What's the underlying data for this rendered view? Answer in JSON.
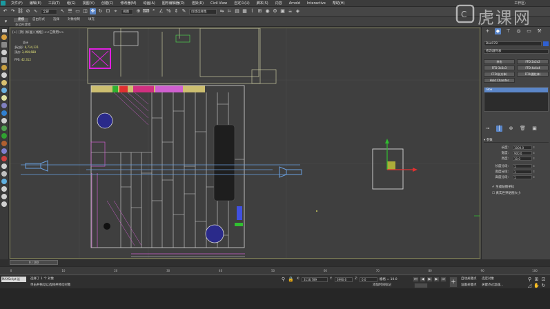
{
  "menubar": {
    "items": [
      "文件(F)",
      "编辑(E)",
      "工具(T)",
      "组(G)",
      "视图(V)",
      "创建(C)",
      "修改器(M)",
      "动画(A)",
      "图形编辑器(D)",
      "渲染(R)",
      "Civil View",
      "自定义(U)",
      "脚本(S)",
      "内容",
      "Arnold",
      "Interactive",
      "帮助(H)"
    ],
    "workspace_label": "工作区:"
  },
  "toolbar": {
    "filter_value": "全部",
    "selection_set_placeholder": "创建选择集"
  },
  "ribbon": {
    "tabs": [
      "建模",
      "自由形式",
      "选择",
      "对象绘制",
      "填充"
    ],
    "active_tab": 0,
    "sub_label": "多边形建模"
  },
  "viewport": {
    "label": "[+] [顶] [标准] [线框] <<已禁用>>",
    "stats_title": "总计",
    "polys_label": "多边形:",
    "polys_value": "6,734,221",
    "verts_label": "顶点:",
    "verts_value": "3,494,688",
    "fps_label": "FPS:",
    "fps_value": "42.312"
  },
  "command_panel": {
    "object_name": "Box078",
    "modifier_list": "修改器列表",
    "buttons": [
      "挤出",
      "FFD 2x2x2",
      "FFD 3x3x3",
      "FFD 4x4x4",
      "FFD(长方体)",
      "FFD(圆柱体)",
      "Hold Chamfer"
    ],
    "stack_item": "Box",
    "section_title": "参数",
    "params": [
      {
        "label": "长度:",
        "value": "1000.0"
      },
      {
        "label": "宽度:",
        "value": "900.0"
      },
      {
        "label": "高度:",
        "value": "10.0"
      },
      {
        "label": "长度分段:",
        "value": "1"
      },
      {
        "label": "宽度分段:",
        "value": "1"
      },
      {
        "label": "高度分段:",
        "value": "1"
      }
    ],
    "checkbox1": "生成贴图坐标",
    "checkbox2": "真实世界贴图大小"
  },
  "timeline": {
    "slider_label": "0 / 100",
    "ticks": [
      "0",
      "10",
      "20",
      "30",
      "40",
      "50",
      "60",
      "70",
      "80",
      "90",
      "100"
    ]
  },
  "statusbar": {
    "script_label": "MAXScript 迷",
    "selection_text": "选择了 1 个 对象",
    "prompt_text": "单击并拖动以选择并移动对象",
    "x_value": "3116.789",
    "y_value": "3990.6",
    "z_value": "0.0",
    "grid_text": "栅格 = 10.0",
    "add_time_tag": "添加时间标记",
    "auto_key": "自动关键点",
    "selected_object": "选定对象",
    "set_key": "设置关键点",
    "key_filters": "关键点过滤器..."
  },
  "watermark": {
    "text": "虎课网"
  },
  "colors": {
    "accent": "#5b86c8",
    "viewport_bg": "#3f3f3f",
    "wire_white": "#d8d8d8",
    "wire_pink": "#d060d0",
    "wire_blue": "#6aa0e0",
    "magenta": "#e020e0",
    "gizmo_red": "#e03030",
    "gizmo_green": "#30c030",
    "gizmo_yellow": "#c8c838"
  }
}
